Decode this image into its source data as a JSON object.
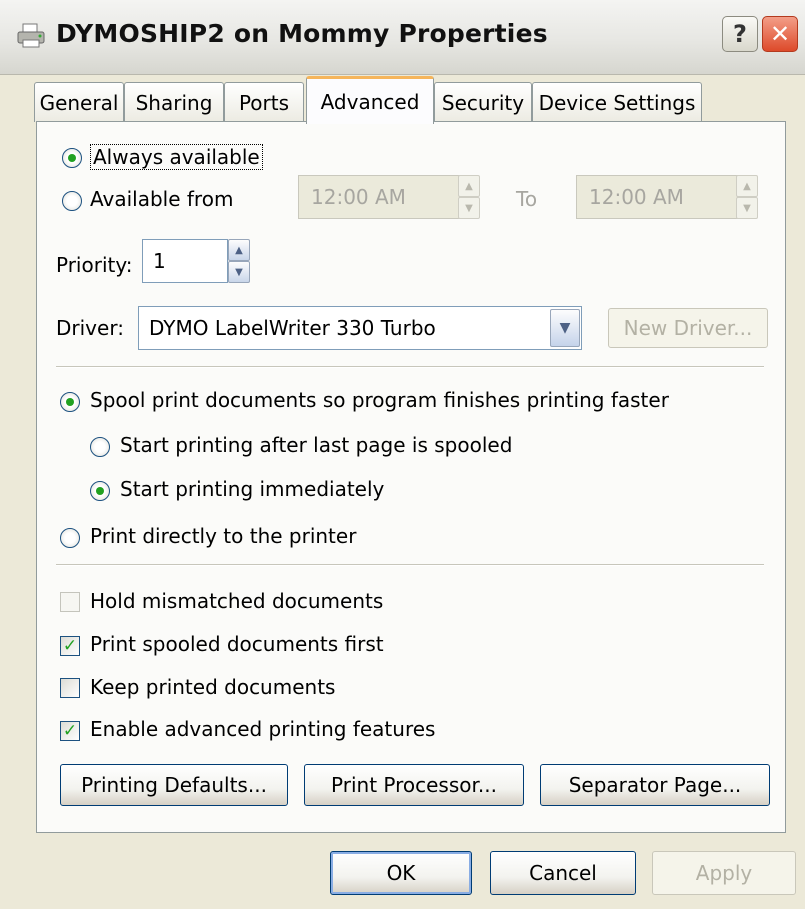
{
  "window": {
    "title": "DYMOSHIP2 on Mommy Properties",
    "help_label": "?",
    "close_label": "✕"
  },
  "tabs": [
    {
      "label": "General"
    },
    {
      "label": "Sharing"
    },
    {
      "label": "Ports"
    },
    {
      "label": "Advanced"
    },
    {
      "label": "Security"
    },
    {
      "label": "Device Settings"
    }
  ],
  "availability": {
    "always_label": "Always available",
    "from_label": "Available from",
    "from_time": "12:00 AM",
    "to_label": "To",
    "to_time": "12:00 AM"
  },
  "priority": {
    "label": "Priority:",
    "value": "1"
  },
  "driver": {
    "label": "Driver:",
    "value": "DYMO LabelWriter 330 Turbo",
    "new_driver_label": "New Driver..."
  },
  "spooling": {
    "spool_label": "Spool print documents so program finishes printing faster",
    "after_last_label": "Start printing after last page is spooled",
    "immediately_label": "Start printing immediately",
    "direct_label": "Print directly to the printer"
  },
  "options": {
    "hold_label": "Hold mismatched documents",
    "spooled_first_label": "Print spooled documents first",
    "keep_label": "Keep printed documents",
    "advanced_label": "Enable advanced printing features"
  },
  "panel_buttons": {
    "defaults": "Printing Defaults...",
    "processor": "Print Processor...",
    "separator": "Separator Page..."
  },
  "footer": {
    "ok": "OK",
    "cancel": "Cancel",
    "apply": "Apply"
  },
  "colors": {
    "accent_check": "#21a121",
    "active_tab_border": "#f5b55b",
    "close_button": "#dd4a2a"
  }
}
